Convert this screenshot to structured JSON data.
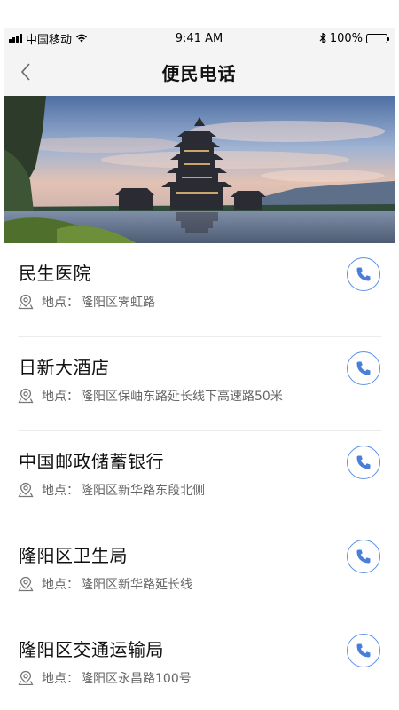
{
  "status_bar": {
    "carrier": "中国移动",
    "time": "9:41 AM",
    "battery": "100%",
    "icons": [
      "signal-icon",
      "wifi-icon",
      "bluetooth-icon",
      "battery-icon"
    ]
  },
  "nav": {
    "title": "便民电话",
    "back_icon": "chevron-left-icon"
  },
  "banner": {
    "icon": "pagoda-landscape-photo"
  },
  "contacts": [
    {
      "name": "民生医院",
      "addr_label": "地点：",
      "address": "隆阳区霁虹路"
    },
    {
      "name": "日新大酒店",
      "addr_label": "地点：",
      "address": "隆阳区保岫东路延长线下高速路50米"
    },
    {
      "name": "中国邮政储蓄银行",
      "addr_label": "地点：",
      "address": "隆阳区新华路东段北侧"
    },
    {
      "name": "隆阳区卫生局",
      "addr_label": "地点：",
      "address": "隆阳区新华路延长线"
    },
    {
      "name": "隆阳区交通运输局",
      "addr_label": "地点：",
      "address": "隆阳区永昌路100号"
    }
  ],
  "colors": {
    "accent": "#5b8fe6",
    "nav_bg": "#f4f4f4",
    "divider": "#ececec"
  }
}
